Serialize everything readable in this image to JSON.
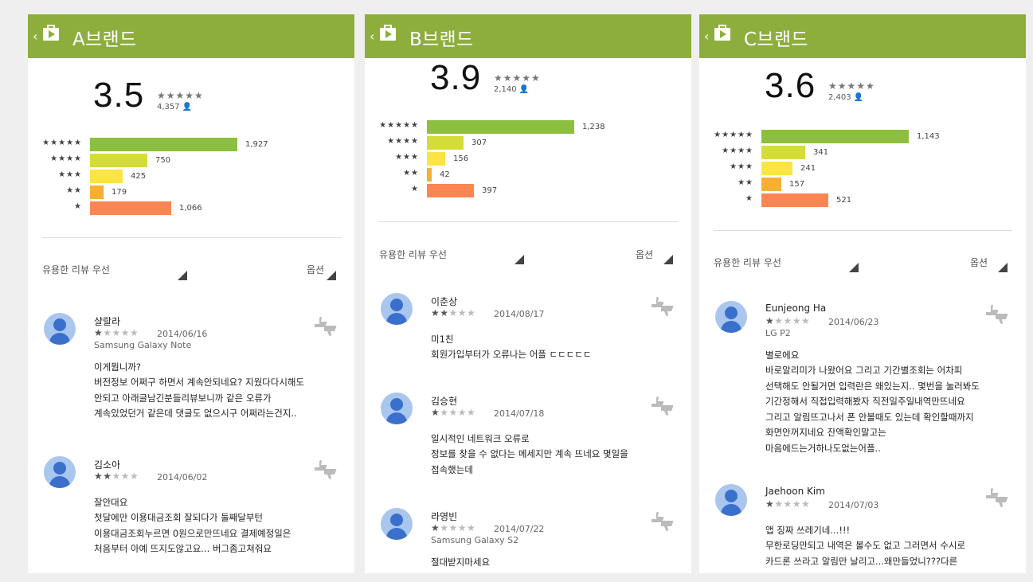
{
  "panels": [
    {
      "brand": "A브랜드",
      "score": "3.5",
      "mini_stars": "★★★★★",
      "total": "4,357",
      "bars": [
        {
          "label": "★★★★★",
          "value": 1927,
          "display": "1,927",
          "color": "#8cbf3f"
        },
        {
          "label": "★★★★",
          "value": 750,
          "display": "750",
          "color": "#d4dc38"
        },
        {
          "label": "★★★",
          "value": 425,
          "display": "425",
          "color": "#fce443"
        },
        {
          "label": "★★",
          "value": 179,
          "display": "179",
          "color": "#f8b032"
        },
        {
          "label": "★",
          "value": 1066,
          "display": "1,066",
          "color": "#fb8653"
        }
      ],
      "sort_label": "유용한 리뷰 우선",
      "options_label": "옵션",
      "reviews": [
        {
          "name": "샬랄라",
          "stars": 1,
          "date": "2014/06/16",
          "device": "Samsung Galaxy Note",
          "title": "이게뭡니까?",
          "body": [
            "버전정보 어쩌구 하면서 계속안되네요? 지웠다다시해도",
            "안되고 아래글남긴분들리뷰보니까 같은 오류가",
            "계속있었던거 같은데 댓글도 없으시구 어쩌라는건지.."
          ]
        },
        {
          "name": "김소아",
          "stars": 2,
          "date": "2014/06/02",
          "device": "",
          "title": "잘안대요",
          "body": [
            "첫달에만 이용대금조회 잘되다가 둘째달부턴",
            "이용대금조회누르면 0원으로만뜨네요 결제예정일은",
            "처음부터 아예 뜨지도않고요... 버그좀고쳐줘요"
          ]
        }
      ]
    },
    {
      "brand": "B브랜드",
      "score": "3.9",
      "mini_stars": "★★★★★",
      "total": "2,140",
      "bars": [
        {
          "label": "★★★★★",
          "value": 1238,
          "display": "1,238",
          "color": "#8cbf3f"
        },
        {
          "label": "★★★★",
          "value": 307,
          "display": "307",
          "color": "#d4dc38"
        },
        {
          "label": "★★★",
          "value": 156,
          "display": "156",
          "color": "#fce443"
        },
        {
          "label": "★★",
          "value": 42,
          "display": "42",
          "color": "#f8b032"
        },
        {
          "label": "★",
          "value": 397,
          "display": "397",
          "color": "#fb8653"
        }
      ],
      "sort_label": "유용한 리뷰 우선",
      "options_label": "옵션",
      "reviews": [
        {
          "name": "이춘상",
          "stars": 2,
          "date": "2014/08/17",
          "device": "",
          "title": "미1친",
          "body": [
            "회원가입부터가 오류나는 어플 ㄷㄷㄷㄷㄷ"
          ]
        },
        {
          "name": "김승현",
          "stars": 1,
          "date": "2014/07/18",
          "device": "",
          "title": "일시적인 네트워크 오류로",
          "body": [
            "정보를 찾을 수 없다는 메세지만 계속 뜨네요 몇일을",
            "접속했는데"
          ]
        },
        {
          "name": "라영빈",
          "stars": 1,
          "date": "2014/07/22",
          "device": "Samsung Galaxy S2",
          "title": "절대받지마세요",
          "body": []
        }
      ]
    },
    {
      "brand": "C브랜드",
      "score": "3.6",
      "mini_stars": "★★★★★",
      "total": "2,403",
      "bars": [
        {
          "label": "★★★★★",
          "value": 1143,
          "display": "1,143",
          "color": "#8cbf3f"
        },
        {
          "label": "★★★★",
          "value": 341,
          "display": "341",
          "color": "#d4dc38"
        },
        {
          "label": "★★★",
          "value": 241,
          "display": "241",
          "color": "#fce443"
        },
        {
          "label": "★★",
          "value": 157,
          "display": "157",
          "color": "#f8b032"
        },
        {
          "label": "★",
          "value": 521,
          "display": "521",
          "color": "#fb8653"
        }
      ],
      "sort_label": "유용한 리뷰 우선",
      "options_label": "옵션",
      "reviews": [
        {
          "name": "Eunjeong Ha",
          "stars": 1,
          "date": "2014/06/23",
          "device": "LG P2",
          "title": "별로에요",
          "body": [
            "바로알리미가 나왔어요 그리고 기간별조회는 어차피",
            "선택해도 안될거면 입력란은 왜있는지.. 몇번을 눌러봐도",
            "기간정해서 직접입력해봤자 직전일주일내역만뜨네요",
            "그리고 알림뜨고나서 폰 안볼때도 있는데 확인할때까지",
            "화면안꺼지네요 잔액확인말고는",
            "마음에드는거하나도없는어플.."
          ]
        },
        {
          "name": "Jaehoon Kim",
          "stars": 1,
          "date": "2014/07/03",
          "device": "",
          "title": "앱 징짜 쓰레기네...!!!",
          "body": [
            "무한로딩만되고 내역은 볼수도 없고 그러면서 수시로",
            "카드론 쓰라고 알림만 날리고...왜만들었니???다른"
          ]
        }
      ]
    }
  ]
}
